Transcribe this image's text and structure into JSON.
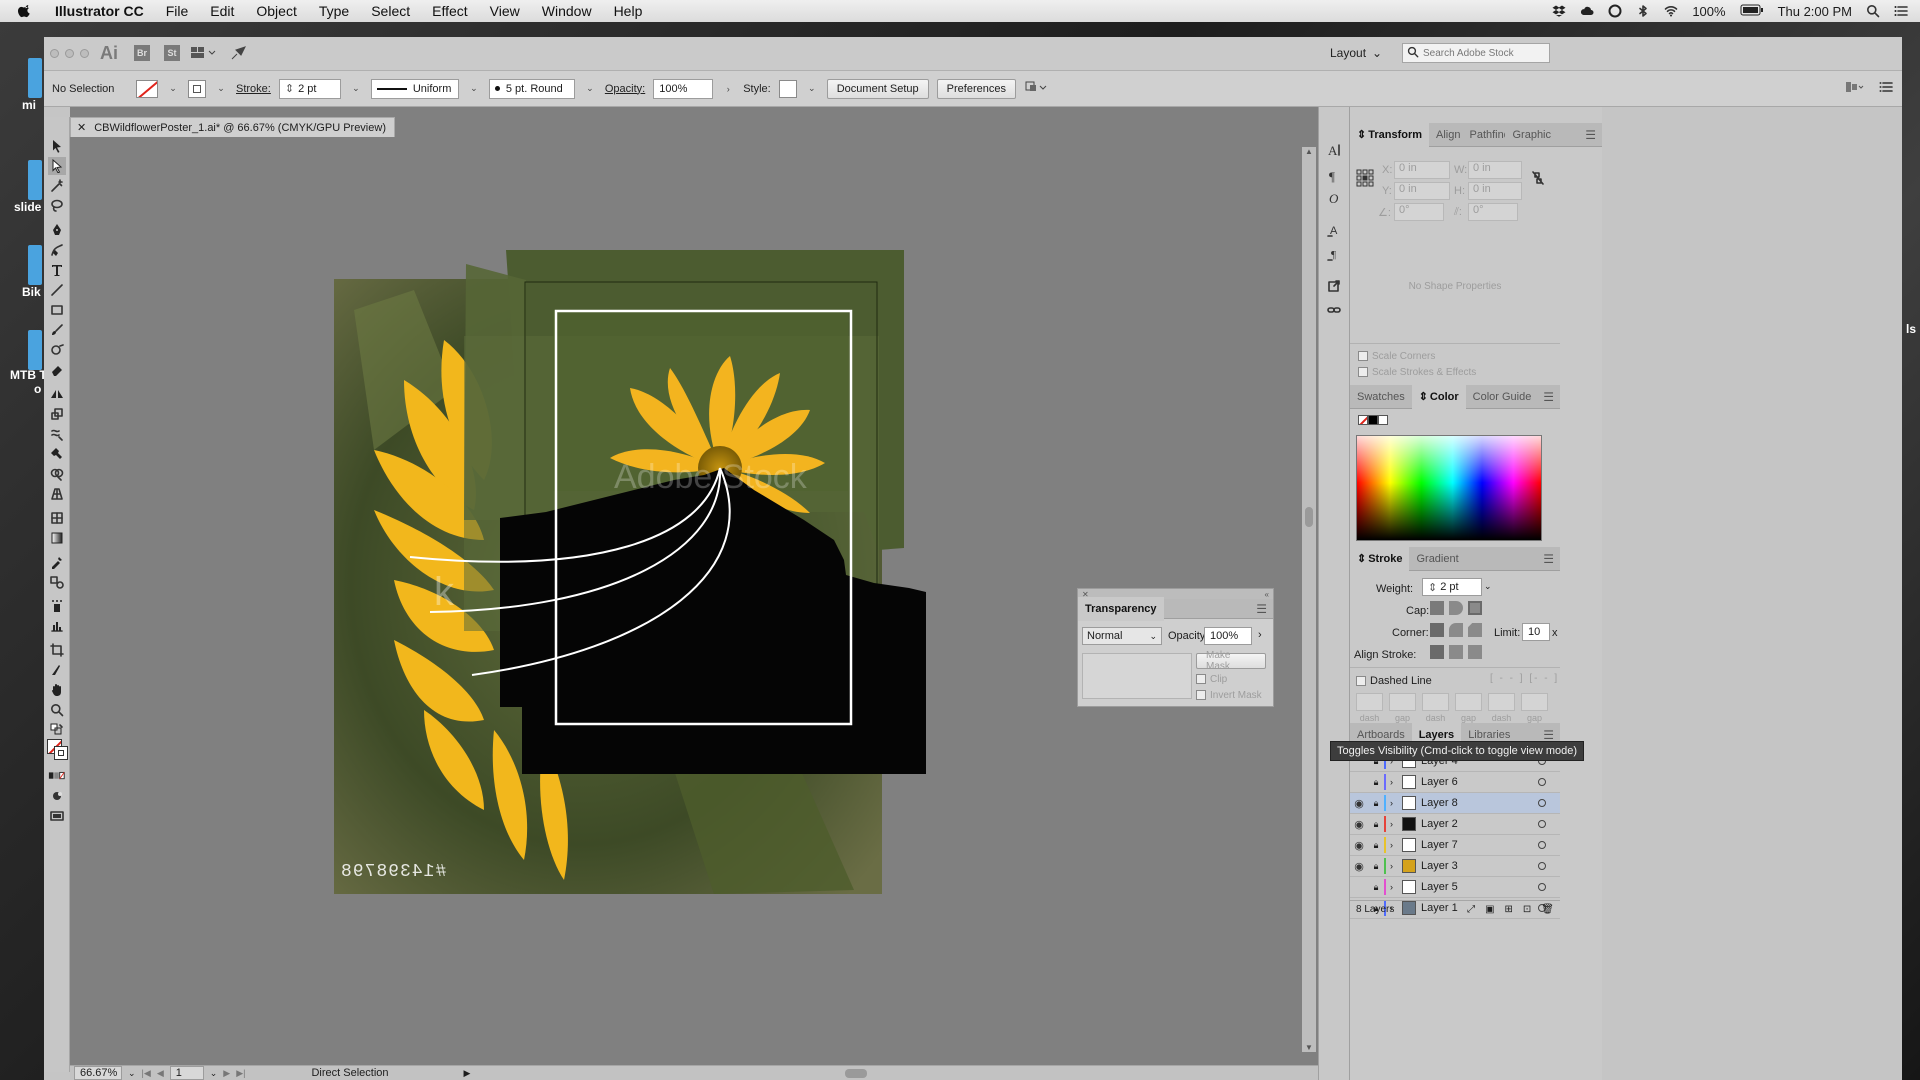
{
  "menubar": {
    "app_name": "Illustrator CC",
    "menus": [
      "File",
      "Edit",
      "Object",
      "Type",
      "Select",
      "Effect",
      "View",
      "Window",
      "Help"
    ],
    "battery": "100%",
    "clock": "Thu 2:00 PM"
  },
  "desktop": {
    "labels": [
      "mi",
      "slide",
      "Bik",
      "MTB T",
      "o",
      "ls"
    ]
  },
  "appbar": {
    "logo": "Ai",
    "bridge": "Br",
    "stock": "St",
    "workspace": "Layout",
    "search_placeholder": "Search Adobe Stock"
  },
  "controlbar": {
    "selection": "No Selection",
    "stroke_label": "Stroke:",
    "stroke_value": "2 pt",
    "profile": "Uniform",
    "brush": "5 pt. Round",
    "opacity_label": "Opacity:",
    "opacity_value": "100%",
    "style_label": "Style:",
    "doc_setup": "Document Setup",
    "preferences": "Preferences"
  },
  "document": {
    "tab_title": "CBWildflowerPoster_1.ai* @ 66.67% (CMYK/GPU Preview)",
    "art_text": "#14398798",
    "zoom": "66.67%",
    "artboard": "1",
    "status": "Direct Selection"
  },
  "transform_panel": {
    "tabs": [
      "Transform",
      "Align",
      "Pathfinder",
      "Graphic"
    ],
    "x_label": "X:",
    "x_value": "0 in",
    "y_label": "Y:",
    "y_value": "0 in",
    "w_label": "W:",
    "w_value": "0 in",
    "h_label": "H:",
    "h_value": "0 in",
    "angle_value": "0°",
    "shear_value": "0°",
    "shape_note": "No Shape Properties",
    "scale_corners": "Scale Corners",
    "scale_strokes": "Scale Strokes & Effects"
  },
  "color_panel": {
    "tabs": [
      "Swatches",
      "Color",
      "Color Guide"
    ]
  },
  "stroke_panel": {
    "tabs": [
      "Stroke",
      "Gradient"
    ],
    "weight_label": "Weight:",
    "weight_value": "2 pt",
    "cap_label": "Cap:",
    "corner_label": "Corner:",
    "limit_label": "Limit:",
    "limit_value": "10",
    "limit_unit": "x",
    "align_label": "Align Stroke:",
    "dashed_label": "Dashed Line",
    "dash_labels": [
      "dash",
      "gap",
      "dash",
      "gap",
      "dash",
      "gap"
    ]
  },
  "layers_panel": {
    "tabs": [
      "Artboards",
      "Layers",
      "Libraries"
    ],
    "layers": [
      {
        "name": "Layer 4",
        "color": "#4f6bff",
        "visible": false
      },
      {
        "name": "Layer 6",
        "color": "#6b6bff",
        "visible": false
      },
      {
        "name": "Layer 8",
        "color": "#4fb0ff",
        "visible": true
      },
      {
        "name": "Layer 2",
        "color": "#e6433a",
        "visible": true
      },
      {
        "name": "Layer 7",
        "color": "#e8c32a",
        "visible": true
      },
      {
        "name": "Layer 3",
        "color": "#4fc14f",
        "visible": true
      },
      {
        "name": "Layer 5",
        "color": "#e34fd0",
        "visible": false
      },
      {
        "name": "Layer 1",
        "color": "#4f6bff",
        "visible": false
      }
    ],
    "count": "8 Layers",
    "tooltip": "Toggles Visibility (Cmd-click to toggle view mode)"
  },
  "transparency_panel": {
    "title": "Transparency",
    "mode": "Normal",
    "opacity_label": "Opacity:",
    "opacity_value": "100%",
    "make_mask": "Make Mask",
    "clip": "Clip",
    "invert": "Invert Mask"
  }
}
